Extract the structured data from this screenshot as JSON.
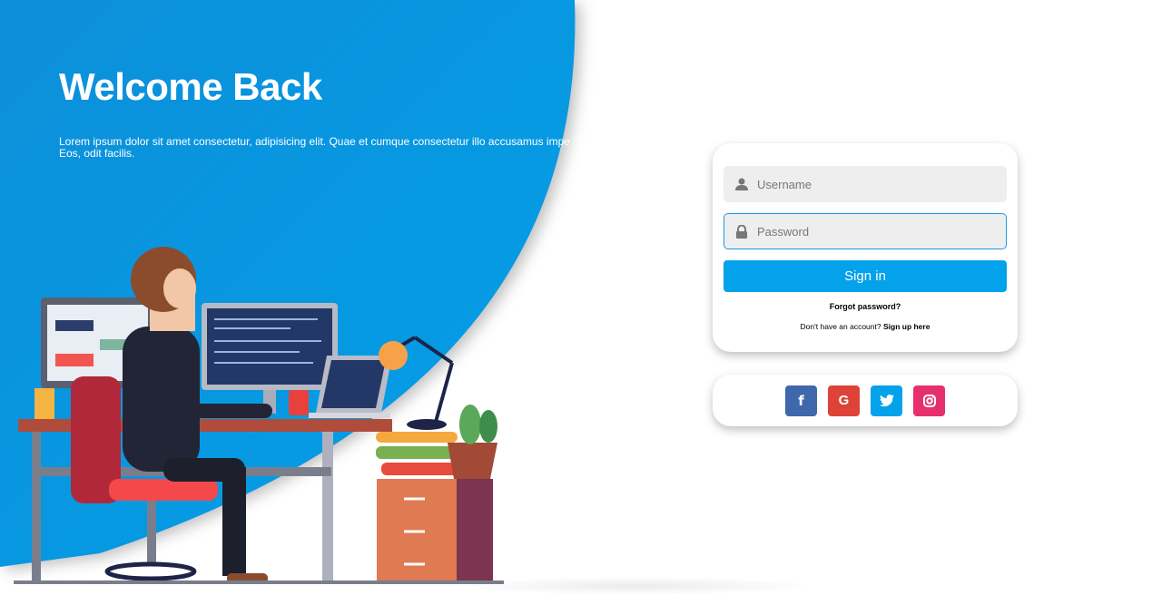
{
  "hero": {
    "title": "Welcome Back",
    "text_line1": "Lorem ipsum dolor sit amet consectetur, adipisicing elit. Quae et cumque consectetur illo accusamus impe",
    "text_line2": "Eos, odit facilis."
  },
  "login": {
    "username_placeholder": "Username",
    "password_placeholder": "Password",
    "signin_label": "Sign in",
    "forgot_label": "Forgot password?",
    "signup_prompt": "Don't have an account?",
    "signup_link": "Sign up here"
  },
  "social": [
    {
      "name": "facebook",
      "glyph": "f",
      "color": "#3f67ab"
    },
    {
      "name": "google",
      "glyph": "G",
      "color": "#de4338"
    },
    {
      "name": "twitter",
      "glyph": "t",
      "color": "#03a2ea"
    },
    {
      "name": "instagram",
      "glyph": "ig",
      "color": "#e6306d"
    }
  ],
  "colors": {
    "brand": "#0a99e0",
    "button": "#03a2ea"
  }
}
